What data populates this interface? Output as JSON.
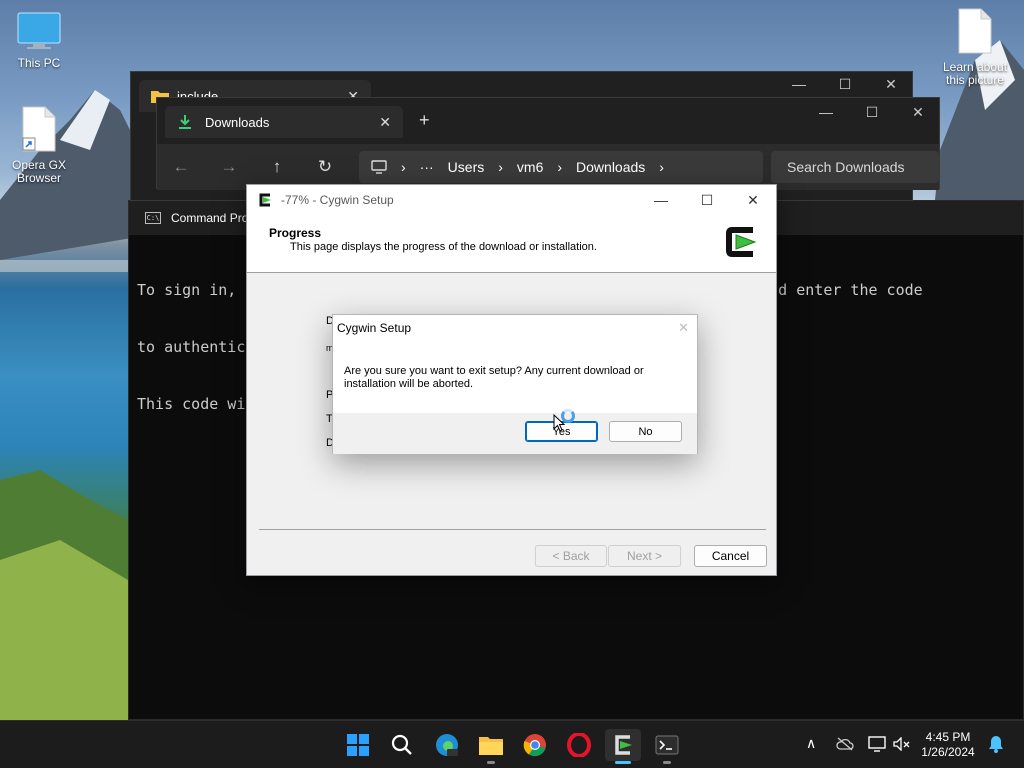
{
  "desktop": {
    "icons": [
      {
        "label": "This PC",
        "icon": "monitor-icon"
      },
      {
        "label": "Opera GX Browser",
        "icon": "file-shortcut-icon"
      },
      {
        "label": "Learn about this picture",
        "icon": "file-icon"
      }
    ]
  },
  "cmd": {
    "title": "Command Pro",
    "lines": [
      "To sign in, u                                              vicelogin and enter the code",
      "to authentica",
      "This code wi"
    ]
  },
  "explorer_back": {
    "tab": "include"
  },
  "explorer_front": {
    "tab": "Downloads",
    "new_tab": "+",
    "breadcrumb": [
      "Users",
      "vm6",
      "Downloads"
    ],
    "more": "···",
    "search_placeholder": "Search Downloads"
  },
  "cygwin": {
    "title": "-77% - Cygwin Setup",
    "heading": "Progress",
    "subheading": "This page displays the progress of the download or installation.",
    "bg_labels": [
      "D",
      "m",
      "P",
      "T",
      "D"
    ],
    "back_label": "< Back",
    "next_label": "Next >",
    "cancel_label": "Cancel"
  },
  "confirm": {
    "title": "Cygwin Setup",
    "message": "Are you sure you want to exit setup? Any current download or installation will be aborted.",
    "yes_label": "Yes",
    "no_label": "No"
  },
  "taskbar": {
    "apps": [
      "start-icon",
      "search-icon",
      "edge-icon",
      "file-explorer-icon",
      "chrome-icon",
      "opera-icon",
      "cygwin-icon",
      "terminal-icon"
    ],
    "time": "4:45 PM",
    "date": "1/26/2024"
  },
  "colors": {
    "accent": "#0067c0",
    "taskbar_active": "#4cc2ff",
    "cygwin_green": "#3fbf3f"
  }
}
